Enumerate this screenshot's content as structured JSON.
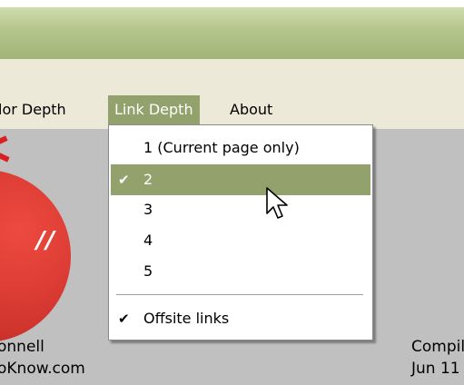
{
  "menubar": {
    "items": [
      {
        "label": "lor Depth"
      },
      {
        "label": "Link Depth"
      },
      {
        "label": "About"
      }
    ]
  },
  "link_depth_menu": {
    "items": [
      {
        "label": "1 (Current page only)",
        "checked": false
      },
      {
        "label": "2",
        "checked": true
      },
      {
        "label": "3",
        "checked": false
      },
      {
        "label": "4",
        "checked": false
      },
      {
        "label": "5",
        "checked": false
      }
    ],
    "offsite": {
      "label": "Offsite links",
      "checked": true
    },
    "check_glyph": "✔"
  },
  "content": {
    "credit_name": "onnell",
    "credit_site": "oKnow.com",
    "compiled_label": "Compile",
    "compiled_date": "Jun 11"
  },
  "icons": {
    "logo": "logo-icon",
    "cursor": "mouse-pointer-icon",
    "check": "checkmark-icon"
  },
  "colors": {
    "titlebar": "#b3c58a",
    "menubar_bg": "#ece9d8",
    "highlight": "#93a16c",
    "content_bg": "#c0c0c0",
    "logo_red": "#d83a32"
  }
}
